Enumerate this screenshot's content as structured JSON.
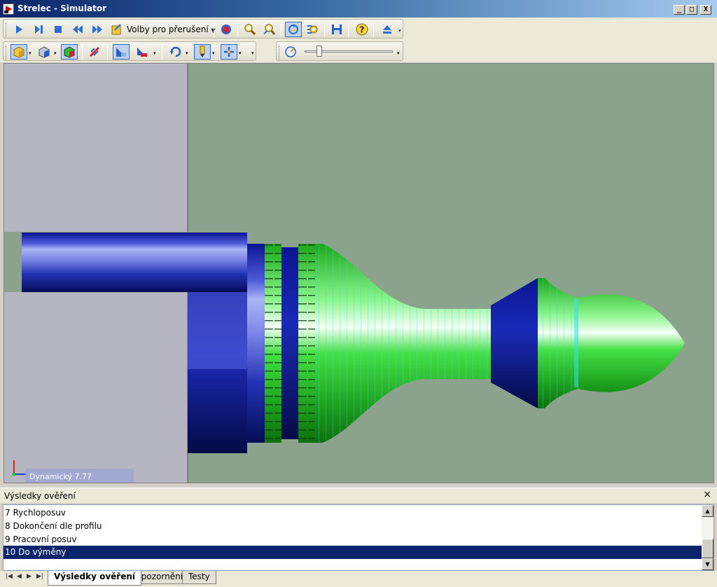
{
  "window": {
    "title": "Strelec - Simulator",
    "minimize": "_",
    "maximize": "□",
    "close": "X"
  },
  "toolbar": {
    "interrupt_options_label": "Volby pro přerušení",
    "speed_slider_value": 0.14,
    "icons_row1": [
      "play-icon",
      "step-icon",
      "stop-icon",
      "rewind-icon",
      "fast-forward-icon",
      "interrupt-options-icon",
      "record-icon",
      "zoom-icon",
      "zoom-fit-icon",
      "rotate-view-icon",
      "settings-icon",
      "save-icon",
      "help-icon",
      "eject-icon"
    ],
    "icons_row2": [
      "stock-view-icon",
      "tool-view-icon",
      "part-view-icon",
      "measure-icon",
      "section-view-icon",
      "cut-plane-icon",
      "rotate-icon",
      "tool-holder-icon",
      "axes-icon",
      "speed-icon"
    ]
  },
  "viewport": {
    "status_label": "Dynamický 7.77",
    "background_color": "#8ba38d",
    "chuck_color": "#b6b6c2",
    "stock_color": "#1a2ab8",
    "part_color": "#2fd62f"
  },
  "results": {
    "header": "Výsledky ověření",
    "close": "×",
    "items": [
      {
        "label": "7 Rychloposuv",
        "selected": false
      },
      {
        "label": "8 Dokončení dle profilu",
        "selected": false
      },
      {
        "label": "9 Pracovní posuv",
        "selected": false
      },
      {
        "label": "10 Do výměny",
        "selected": true
      }
    ]
  },
  "tabs": [
    {
      "label": "Výsledky ověření",
      "active": true
    },
    {
      "label": "Upozornění",
      "active": false
    },
    {
      "label": "Testy",
      "active": false
    }
  ]
}
